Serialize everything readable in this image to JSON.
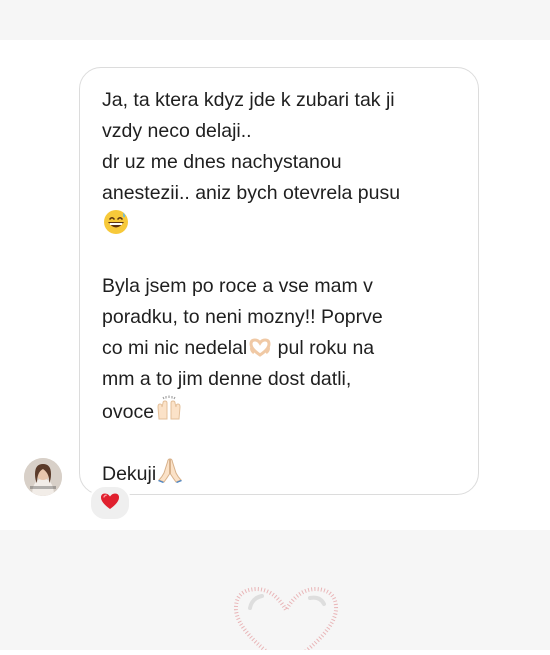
{
  "message": {
    "lines_block1": [
      "Ja, ta ktera kdyz jde k zubari tak ji",
      "vzdy neco delaji.."
    ],
    "lines_block2": [
      "dr uz me dnes nachystanou",
      "anestezii.. aniz bych otevrela pusu"
    ],
    "lines_block3": [
      "Byla jsem po roce a vse mam v",
      "poradku, to neni mozny!! Poprve"
    ],
    "line_heart_prefix": "co mi nic nedelal",
    "line_heart_suffix": " pul roku na",
    "line_mm": "mm a to jim denne dost datli,",
    "line_ovoce": "ovoce",
    "line_dekuji": "Dekuji"
  },
  "icons": {
    "emoji_sweat_smile": "grinning-sweat-emoji-icon",
    "emoji_heart_hands": "heart-hands-emoji-icon",
    "emoji_raising_hands": "raising-hands-emoji-icon",
    "emoji_folded_hands": "folded-hands-emoji-icon",
    "reaction": "red-heart-icon",
    "decoration": "outline-heart-icon"
  },
  "colors": {
    "reaction_heart": "#e0202e",
    "decor_heart": "#e9b6b8",
    "bubble_border": "#dcdcdc",
    "band": "#f6f6f6"
  }
}
